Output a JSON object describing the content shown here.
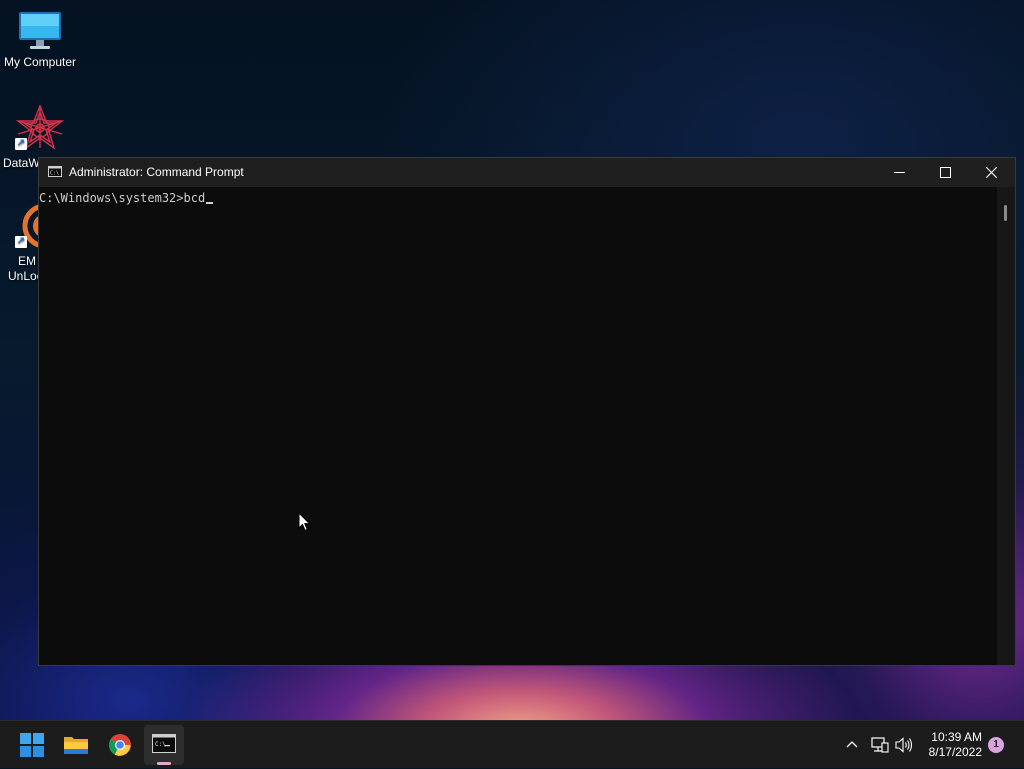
{
  "desktop": {
    "icons": [
      {
        "label": "My Computer",
        "icon": "monitor-icon"
      },
      {
        "label": "DataW",
        "icon": "datawrapper-icon"
      },
      {
        "label_line1": "EM",
        "label_line2": "UnLoc",
        "icon": "unlocker-icon"
      }
    ]
  },
  "cmd_window": {
    "title": "Administrator: Command Prompt",
    "lines": [
      "C:\\Windows\\system32>bcd"
    ],
    "controls": {
      "minimize": "minimize-icon",
      "maximize": "maximize-icon",
      "close": "close-icon"
    }
  },
  "taskbar": {
    "apps": [
      {
        "name": "Start",
        "icon": "windows-logo-icon"
      },
      {
        "name": "File Explorer",
        "icon": "folder-icon"
      },
      {
        "name": "Google Chrome",
        "icon": "chrome-icon"
      },
      {
        "name": "Command Prompt",
        "icon": "terminal-icon",
        "active": true
      }
    ],
    "tray": {
      "icons": [
        "chevron-up-icon",
        "network-icon",
        "volume-icon"
      ],
      "time": "10:39 AM",
      "date": "8/17/2022",
      "notification_count": "1"
    }
  },
  "colors": {
    "console_bg": "#0c0c0c",
    "titlebar_bg": "#1f1f1f",
    "taskbar_bg": "#1c1c1c",
    "accent": "#0078d4"
  }
}
